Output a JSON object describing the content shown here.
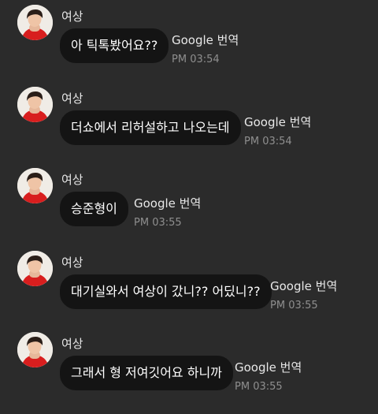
{
  "messages": [
    {
      "sender": "여상",
      "text": "아 틱톡봤어요??",
      "translate": "Google 번역",
      "time": "PM 03:54"
    },
    {
      "sender": "여상",
      "text": "더쇼에서 리허설하고 나오는데",
      "translate": "Google 번역",
      "time": "PM 03:54"
    },
    {
      "sender": "여상",
      "text": "승준형이",
      "translate": "Google 번역",
      "time": "PM 03:55"
    },
    {
      "sender": "여상",
      "text": "대기실와서 여상이 갔니?? 어딨니??",
      "translate": "Google 번역",
      "time": "PM 03:55"
    },
    {
      "sender": "여상",
      "text": "그래서 형 저여깃어요 하니까",
      "translate": "Google 번역",
      "time": "PM 03:55"
    }
  ]
}
